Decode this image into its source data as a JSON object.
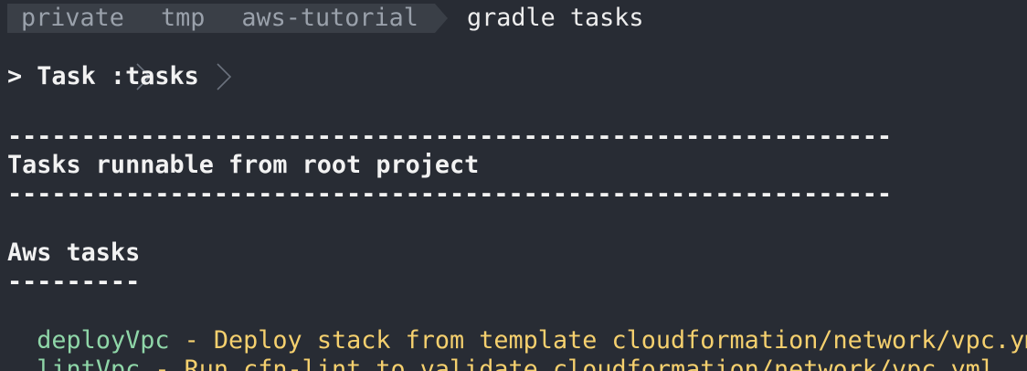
{
  "prompt": {
    "path": [
      "private",
      "tmp",
      "aws-tutorial"
    ],
    "command": "gradle tasks"
  },
  "output": {
    "task_header": "> Task :tasks",
    "divider_long": "------------------------------------------------------------",
    "section_title": "Tasks runnable from root project",
    "group_title": "Aws tasks",
    "group_divider": "---------",
    "tasks": [
      {
        "name": "deployVpc",
        "desc": " - Deploy stack from template cloudformation/network/vpc.yml"
      },
      {
        "name": "lintVpc",
        "desc": " - Run cfn-lint to validate cloudformation/network/vpc.yml"
      }
    ]
  },
  "colors": {
    "background": "#282c34",
    "breadcrumb_bg": "#3a3f47",
    "task_name": "#8fd6a8",
    "task_desc": "#f5d06e"
  }
}
